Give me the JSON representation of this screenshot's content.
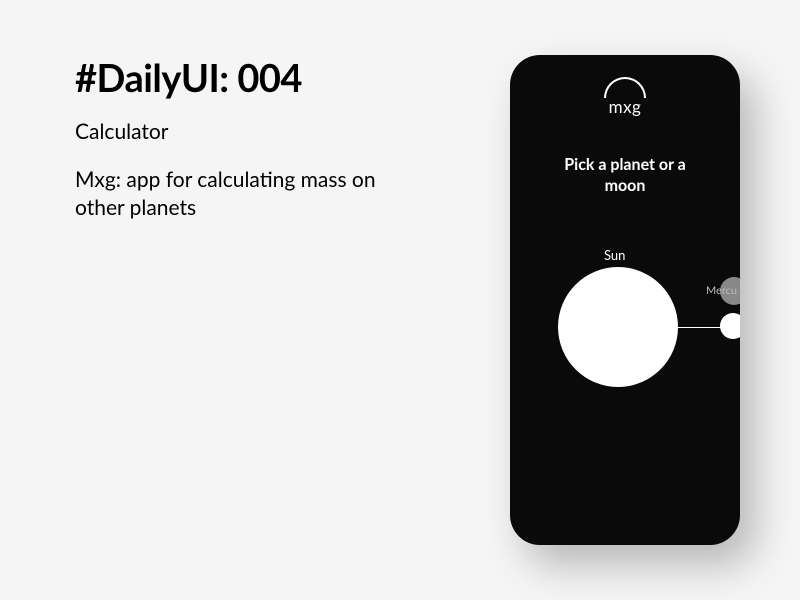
{
  "left": {
    "heading": "#DailyUI: 004",
    "subtitle": "Calculator",
    "description": "Mxg: app for calculating mass on other planets"
  },
  "phone": {
    "logo_text": "mxg",
    "prompt": "Pick a planet or a moon",
    "planets": {
      "sun_label": "Sun",
      "mercury_label": "Mercu"
    }
  }
}
